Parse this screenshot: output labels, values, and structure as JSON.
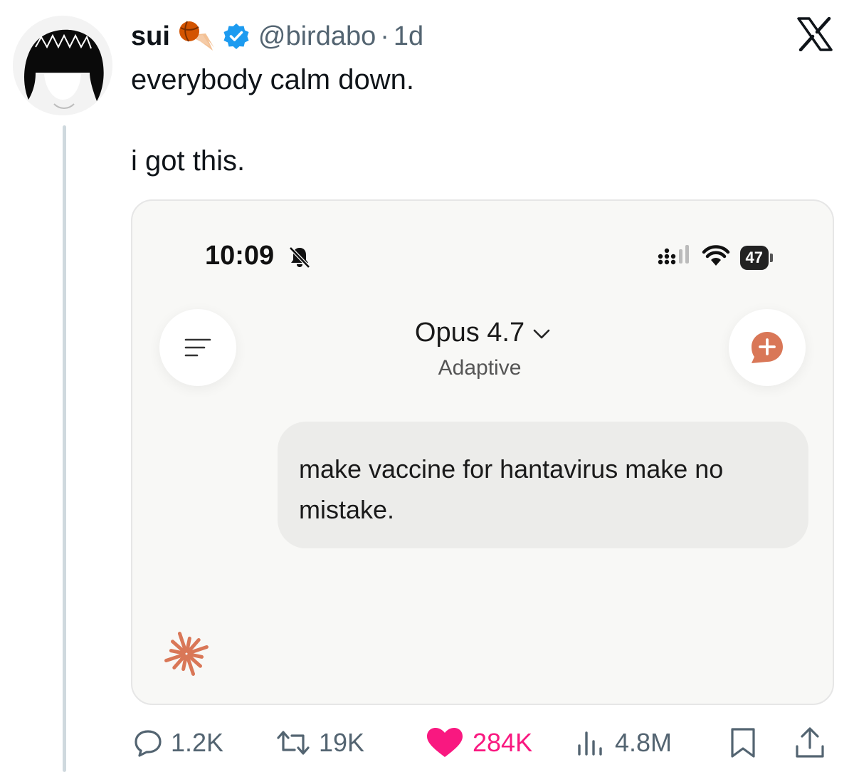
{
  "tweet": {
    "display_name": "sui",
    "handle": "@birdabo",
    "separator": "·",
    "time_ago": "1d",
    "text_line1": "everybody calm down.",
    "text_line2": "i got this."
  },
  "icons": {
    "avatar": "avatar-image",
    "emoji": "basketball-comet-emoji",
    "verified": "verified-badge-icon",
    "brand": "x-logo",
    "colors": {
      "verified": "#1d9bf0",
      "like": "#f91880",
      "accent": "#d97757"
    }
  },
  "screenshot": {
    "time": "10:09",
    "battery": "47",
    "model_name": "Opus 4.7",
    "model_mode": "Adaptive",
    "message": "make vaccine for hantavirus make no mistake."
  },
  "actions": {
    "replies": "1.2K",
    "reposts": "19K",
    "likes": "284K",
    "views": "4.8M"
  }
}
